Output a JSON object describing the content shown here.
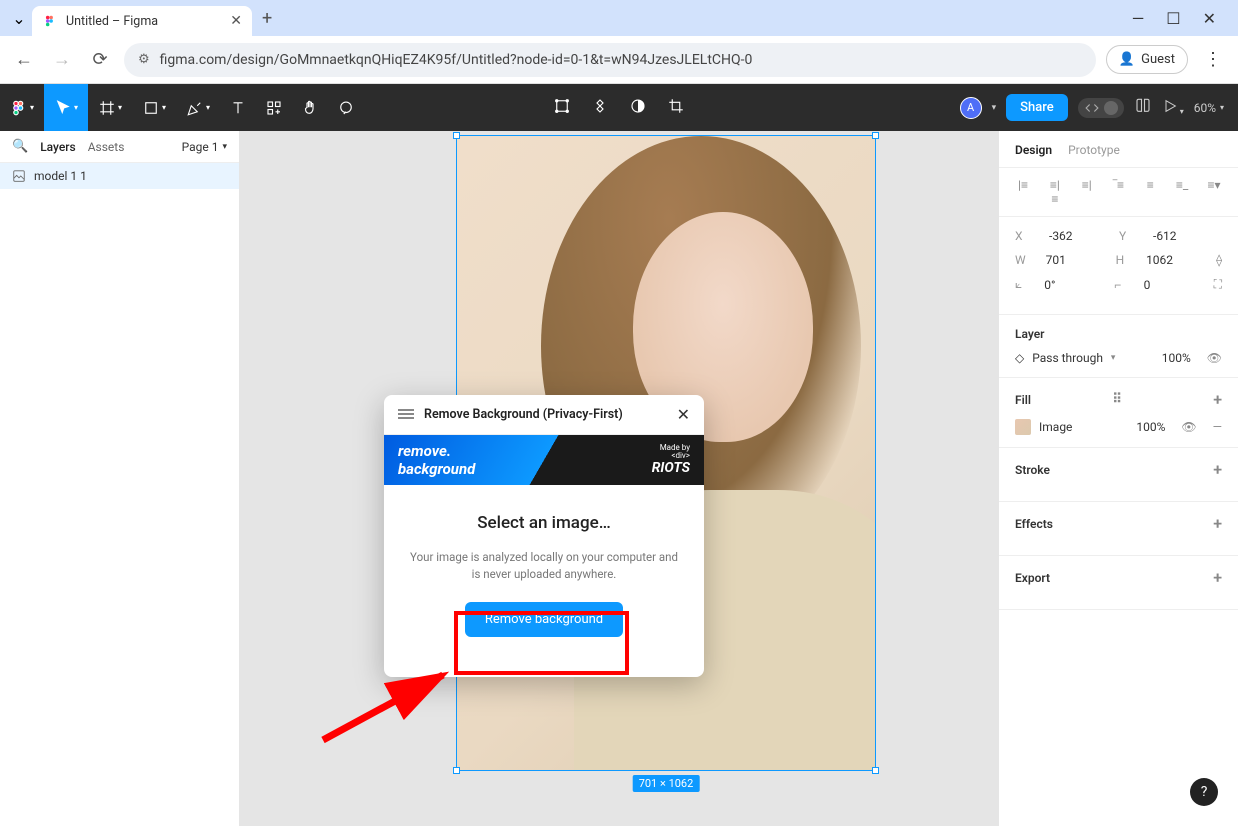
{
  "browser": {
    "tab_title": "Untitled – Figma",
    "url": "figma.com/design/GoMmnaetkqnQHiqEZ4K95f/Untitled?node-id=0-1&t=wN94JzesJLELtCHQ-0",
    "guest_label": "Guest"
  },
  "figma_toolbar": {
    "share_label": "Share",
    "zoom": "60%"
  },
  "left_panel": {
    "tab_layers": "Layers",
    "tab_assets": "Assets",
    "page_label": "Page 1",
    "layer_name": "model 1 1"
  },
  "canvas": {
    "selection_dimensions": "701 × 1062"
  },
  "plugin": {
    "header_title": "Remove Background (Privacy-First)",
    "banner_line1": "remove.",
    "banner_line2": "background",
    "banner_madeby": "Made by",
    "banner_brand_div": "<div>",
    "banner_brand_riots": "RIOTS",
    "heading": "Select an image…",
    "description": "Your image is analyzed locally on your computer and is never uploaded anywhere.",
    "button_label": "Remove background"
  },
  "right_panel": {
    "tab_design": "Design",
    "tab_prototype": "Prototype",
    "x_label": "X",
    "x_val": "-362",
    "y_label": "Y",
    "y_val": "-612",
    "w_label": "W",
    "w_val": "701",
    "h_label": "H",
    "h_val": "1062",
    "rot_label": "⟀",
    "rot_val": "0°",
    "corner_label": "⌐",
    "corner_val": "0",
    "layer_title": "Layer",
    "blend_mode": "Pass through",
    "layer_opacity": "100%",
    "fill_title": "Fill",
    "fill_type": "Image",
    "fill_opacity": "100%",
    "stroke_title": "Stroke",
    "effects_title": "Effects",
    "export_title": "Export"
  },
  "help_label": "?"
}
